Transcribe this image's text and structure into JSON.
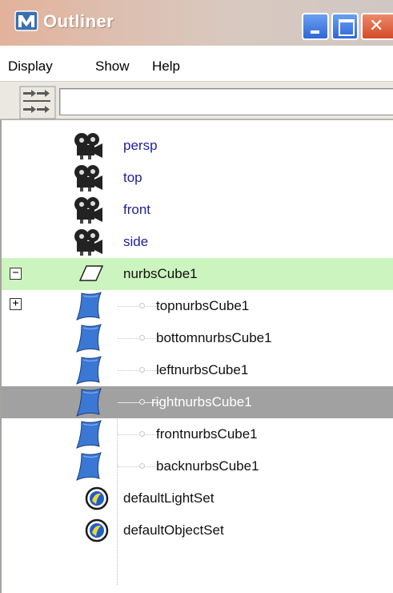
{
  "window": {
    "title": "Outliner",
    "colors": {
      "title_gradient_start": "#e2b29b",
      "title_gradient_end": "#cfc7c2",
      "selected_row": "#a1a1a1",
      "highlight_row": "#ccf4bf",
      "camera_text": "#2020a0"
    }
  },
  "menubar": {
    "items": [
      "Display",
      "Show",
      "Help"
    ]
  },
  "filter": {
    "icon": "filter-icon",
    "value": ""
  },
  "tree": {
    "items": [
      {
        "label": "persp",
        "icon": "camera-icon",
        "kind": "camera"
      },
      {
        "label": "top",
        "icon": "camera-icon",
        "kind": "camera"
      },
      {
        "label": "front",
        "icon": "camera-icon",
        "kind": "camera"
      },
      {
        "label": "side",
        "icon": "camera-icon",
        "kind": "camera"
      },
      {
        "label": "nurbsCube1",
        "icon": "transform-icon",
        "kind": "group",
        "expander": "−",
        "highlighted": true
      },
      {
        "label": "topnurbsCube1",
        "icon": "nurbs-surface-icon",
        "kind": "child",
        "expander": "+"
      },
      {
        "label": "bottomnurbsCube1",
        "icon": "nurbs-surface-icon",
        "kind": "child"
      },
      {
        "label": "leftnurbsCube1",
        "icon": "nurbs-surface-icon",
        "kind": "child"
      },
      {
        "label": "rightnurbsCube1",
        "icon": "nurbs-surface-icon",
        "kind": "child",
        "selected": true
      },
      {
        "label": "frontnurbsCube1",
        "icon": "nurbs-surface-icon",
        "kind": "child"
      },
      {
        "label": "backnurbsCube1",
        "icon": "nurbs-surface-icon",
        "kind": "child"
      },
      {
        "label": "defaultLightSet",
        "icon": "set-icon",
        "kind": "set"
      },
      {
        "label": "defaultObjectSet",
        "icon": "set-icon",
        "kind": "set"
      }
    ]
  }
}
